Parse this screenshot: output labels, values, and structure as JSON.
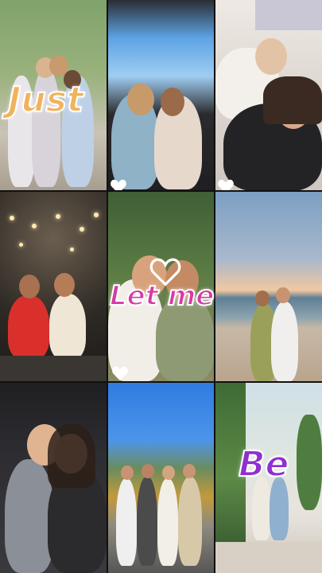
{
  "overlay_words": {
    "word1": "Just",
    "word2": "Let me",
    "word3": "Be"
  },
  "colors": {
    "word1": "#f2b25a",
    "word2": "#d63aa6",
    "word3": "#8f2fd1",
    "heart": "#ffffff"
  },
  "tiles": [
    {
      "name": "tile-friends-street",
      "icon": "photo"
    },
    {
      "name": "tile-car-sunroof",
      "icon": "photo"
    },
    {
      "name": "tile-selfie-duo",
      "icon": "photo"
    },
    {
      "name": "tile-party-lights",
      "icon": "photo"
    },
    {
      "name": "tile-hug-closeup",
      "icon": "photo"
    },
    {
      "name": "tile-beach-sunset",
      "icon": "photo"
    },
    {
      "name": "tile-car-hug",
      "icon": "photo"
    },
    {
      "name": "tile-mountain-group",
      "icon": "photo"
    },
    {
      "name": "tile-greenhouse",
      "icon": "photo"
    }
  ]
}
